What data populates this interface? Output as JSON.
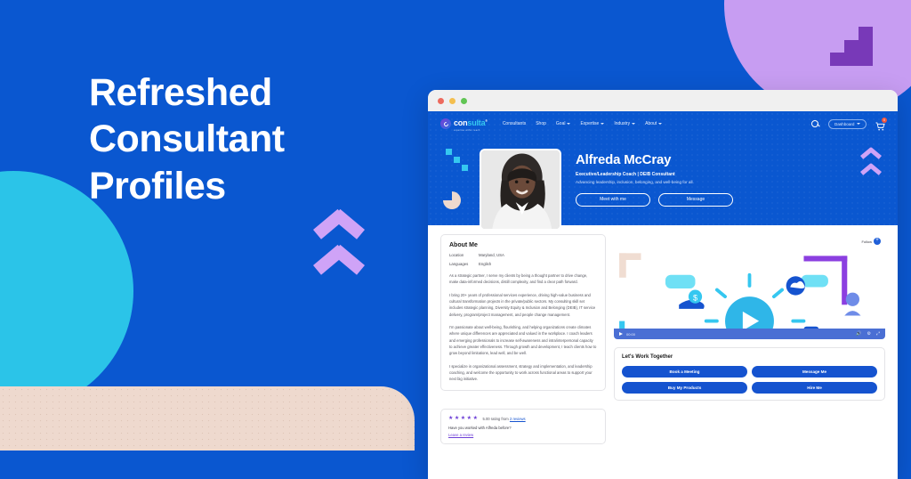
{
  "banner": {
    "headline_lines": [
      "Refreshed",
      "Consultant",
      "Profiles"
    ],
    "colors": {
      "background_blue": "#0a57d0",
      "cyan": "#2bc4e8",
      "beige": "#eed9ce",
      "light_purple": "#c79df2",
      "dark_purple": "#7839b8",
      "chevron_purple": "#cfa3f7"
    }
  },
  "browser": {
    "traffic_lights": [
      "red",
      "yellow",
      "green"
    ]
  },
  "site_nav": {
    "logo_name_part1": "con",
    "logo_name_part2": "sulta",
    "logo_trademark": "®",
    "logo_tagline": "expertise within reach",
    "links": [
      {
        "label": "Consultants",
        "has_caret": false
      },
      {
        "label": "Shop",
        "has_caret": false
      },
      {
        "label": "Goal",
        "has_caret": true
      },
      {
        "label": "Expertise",
        "has_caret": true
      },
      {
        "label": "Industry",
        "has_caret": true
      },
      {
        "label": "About",
        "has_caret": true
      }
    ],
    "search_icon": "search-icon",
    "dashboard_label": "Dashboard",
    "cart_icon": "cart-icon",
    "cart_badge": "0"
  },
  "profile": {
    "name": "Alfreda McCray",
    "role": "Executive/Leadership Coach | DEIB Consultant",
    "tagline": "Advancing leadership, inclusion, belonging, and well-being for all.",
    "buttons": [
      {
        "label": "Meet with me"
      },
      {
        "label": "Message"
      }
    ]
  },
  "about": {
    "title": "About Me",
    "meta": [
      {
        "key": "Location",
        "value": "Maryland, USA"
      },
      {
        "key": "Languages",
        "value": "English"
      }
    ],
    "paragraphs": [
      "As a strategic partner, I serve my clients by being a thought partner to drive change, make data-informed decisions, distill complexity,  and find a clear path forward.",
      "I bring 20+ years of professional services experience, driving high-value business and cultural transformation projects in the private/public sectors. My consulting skill set includes strategic planning, Diversity Equity & Inclusion and Belonging (DEIB), IT service delivery, program/project management, and people change management.",
      "I'm passionate about well-being, flourishing, and helping organizations create climates where unique differences are appreciated and valued in the workplace. I coach leaders  and emerging professionals to increase self-awareness and intra/interpersonal capacity to achieve greater effectiveness. Through growth and development, I teach clients how to grow beyond limitations, lead well, and be well.",
      "I specialize in organizational assessment, strategy and implementation, and leadership coaching, and welcome the opportunity to work across functional areas to support your next big initiative."
    ]
  },
  "video": {
    "follow_label": "Follow",
    "follow_icon": "plus-circle-icon",
    "play_icon": "play-icon",
    "timestamp": "00:00",
    "volume_icon": "volume-icon",
    "settings_icon": "gear-icon",
    "fullscreen_icon": "fullscreen-icon"
  },
  "work_together": {
    "title": "Let's Work Together",
    "buttons": [
      {
        "label": "Book a Meeting"
      },
      {
        "label": "Message Me"
      },
      {
        "label": "Buy My Products"
      },
      {
        "label": "Hire Me"
      }
    ]
  },
  "reviews": {
    "star_count": 5,
    "star_glyph": "★",
    "rating_text": "5.00 rating from ",
    "rating_link": "2 reviews",
    "question": "Have you worked with Alfreda before?",
    "leave_review": "Leave a review"
  }
}
